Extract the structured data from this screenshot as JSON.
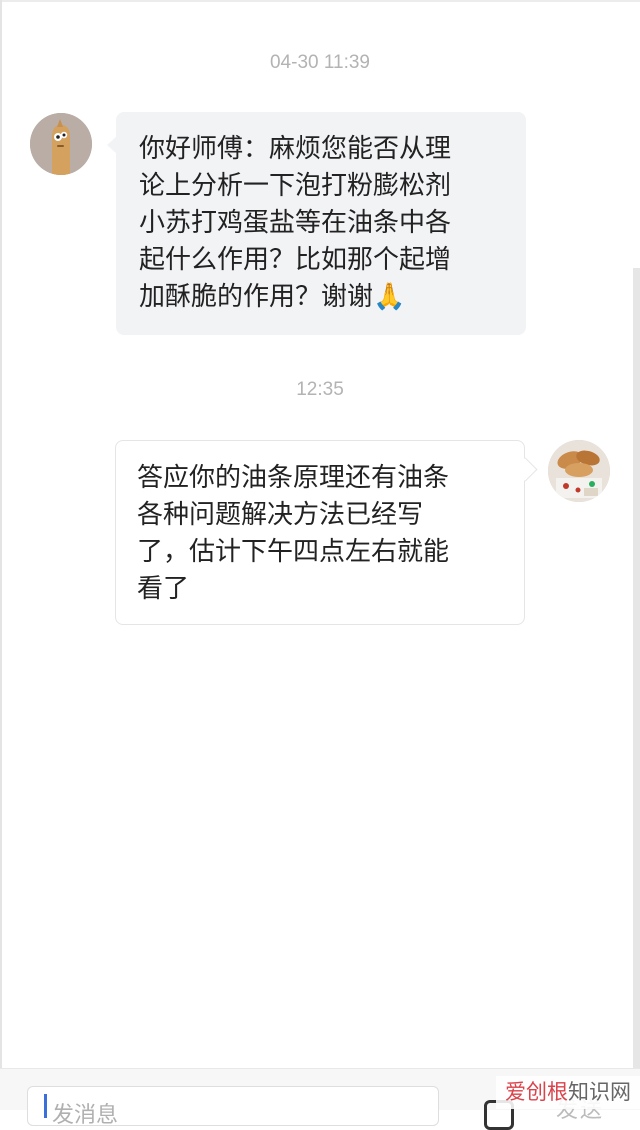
{
  "conversation": {
    "timestamps": [
      "04-30 11:39",
      "12:35"
    ],
    "incoming": {
      "lines": [
        "你好师傅：麻烦您能否从理",
        "论上分析一下泡打粉膨松剂",
        "小苏打鸡蛋盐等在油条中各",
        "起什么作用？比如那个起增"
      ],
      "last_line": "加酥脆的作用？谢谢",
      "emoji": "🙏"
    },
    "outgoing": {
      "lines": [
        "答应你的油条原理还有油条",
        "各种问题解决方法已经写",
        "了，估计下午四点左右就能",
        "看了"
      ]
    }
  },
  "input_bar": {
    "placeholder": "发消息",
    "send_label": "发送"
  },
  "watermark": {
    "part1": "爱创根",
    "part2": "知识网"
  },
  "colors": {
    "incoming_bubble": "#f2f3f5",
    "outgoing_bubble": "#ffffff",
    "timestamp_text": "#b3b3b3",
    "watermark_red": "#d9434b"
  },
  "icons": {
    "incoming_avatar": "cartoon-avatar",
    "outgoing_avatar": "food-photo-avatar",
    "emoji_button": "emoji-icon"
  }
}
